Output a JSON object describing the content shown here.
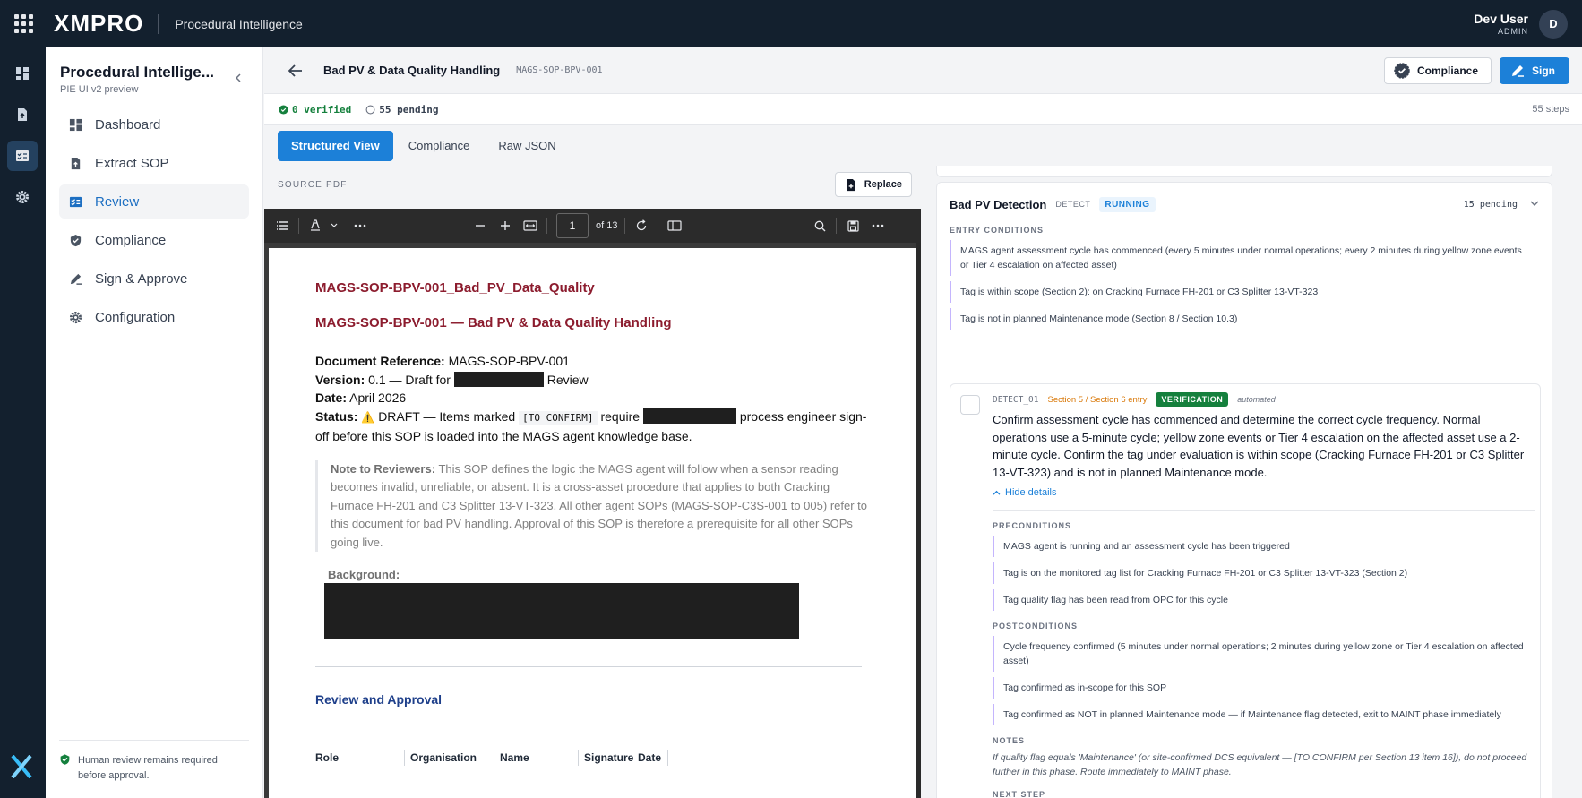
{
  "topbar": {
    "brand": "XMPRO",
    "app_name": "Procedural Intelligence",
    "user_name": "Dev User",
    "user_role": "ADMIN",
    "avatar_initial": "D"
  },
  "sidebar": {
    "title": "Procedural Intellige...",
    "subtitle": "PIE UI v2 preview",
    "items": [
      {
        "label": "Dashboard",
        "icon": "dashboard-icon"
      },
      {
        "label": "Extract SOP",
        "icon": "file-upload-icon"
      },
      {
        "label": "Review",
        "icon": "review-icon",
        "active": true
      },
      {
        "label": "Compliance",
        "icon": "shield-check-icon"
      },
      {
        "label": "Sign & Approve",
        "icon": "pen-icon"
      },
      {
        "label": "Configuration",
        "icon": "gear-icon"
      }
    ],
    "footer_note": "Human review remains required before approval."
  },
  "header": {
    "doc_title": "Bad PV & Data Quality Handling",
    "doc_code": "MAGS-SOP-BPV-001",
    "compliance_label": "Compliance",
    "sign_label": "Sign"
  },
  "status": {
    "verified": "0 verified",
    "pending": "55 pending",
    "steps": "55 steps"
  },
  "tabs": [
    "Structured View",
    "Compliance",
    "Raw JSON"
  ],
  "pdf": {
    "source_label": "SOURCE PDF",
    "replace_label": "Replace",
    "page_number": "1",
    "page_total": "of 13",
    "heading1": "MAGS-SOP-BPV-001_Bad_PV_Data_Quality",
    "heading2": "MAGS-SOP-BPV-001 — Bad PV & Data Quality Handling",
    "docref_label": "Document Reference:",
    "docref_value": "MAGS-SOP-BPV-001",
    "version_label": "Version:",
    "version_value": "0.1 — Draft for",
    "version_suffix": "Review",
    "date_label": "Date:",
    "date_value": "April 2026",
    "status_label": "Status:",
    "status_icon": "⚠️",
    "status_text1": "DRAFT — Items marked",
    "status_tag": "[TO CONFIRM]",
    "status_text2": "require",
    "status_text3": "process engineer sign-off before this SOP is loaded into the MAGS agent knowledge base.",
    "note_label": "Note to Reviewers:",
    "note_text": "This SOP defines the logic the MAGS agent will follow when a sensor reading becomes invalid, unreliable, or absent. It is a cross-asset procedure that applies to both Cracking Furnace FH-201 and C3 Splitter 13-VT-323. All other agent SOPs (MAGS-SOP-C3S-001 to 005) refer to this document for bad PV handling. Approval of this SOP is therefore a prerequisite for all other SOPs going live.",
    "background_label": "Background:",
    "heading3": "Review and Approval",
    "table_headers": [
      "Role",
      "Organisation",
      "Name",
      "Signature",
      "Date"
    ]
  },
  "phase": {
    "title": "Bad PV Detection",
    "code": "DETECT",
    "status": "RUNNING",
    "pending": "15 pending",
    "entry_label": "ENTRY CONDITIONS",
    "entry_conditions": [
      "MAGS agent assessment cycle has commenced (every 5 minutes under normal operations; every 2 minutes during yellow zone events or Tier 4 escalation on affected asset)",
      "Tag is within scope (Section 2): on Cracking Furnace FH-201 or C3 Splitter 13-VT-323",
      "Tag is not in planned Maintenance mode (Section 8 / Section 10.3)"
    ]
  },
  "step": {
    "id": "DETECT_01",
    "ref": "Section 5 / Section 6 entry",
    "badge": "VERIFICATION",
    "mode": "automated",
    "text": "Confirm assessment cycle has commenced and determine the correct cycle frequency. Normal operations use a 5-minute cycle; yellow zone events or Tier 4 escalation on the affected asset use a 2-minute cycle. Confirm the tag under evaluation is within scope (Cracking Furnace FH-201 or C3 Splitter 13-VT-323) and is not in planned Maintenance mode.",
    "hide_details": "Hide details",
    "preconditions_label": "PRECONDITIONS",
    "preconditions": [
      "MAGS agent is running and an assessment cycle has been triggered",
      "Tag is on the monitored tag list for Cracking Furnace FH-201 or C3 Splitter 13-VT-323 (Section 2)",
      "Tag quality flag has been read from OPC for this cycle"
    ],
    "postconditions_label": "POSTCONDITIONS",
    "postconditions": [
      "Cycle frequency confirmed (5 minutes under normal operations; 2 minutes during yellow zone or Tier 4 escalation on affected asset)",
      "Tag confirmed as in-scope for this SOP",
      "Tag confirmed as NOT in planned Maintenance mode — if Maintenance flag detected, exit to MAINT phase immediately"
    ],
    "notes_label": "NOTES",
    "notes": "If quality flag equals 'Maintenance' (or site-confirmed DCS equivalent — [TO CONFIRM per Section 13 item 16]), do not proceed further in this phase. Route immediately to MAINT phase.",
    "next_step_label": "NEXT STEP"
  },
  "colors": {
    "accent": "#1c80d8",
    "topbar": "#13202e",
    "doc_red": "#8c1c2e",
    "doc_blue": "#1e3f8a",
    "verified_green": "#15803d"
  }
}
